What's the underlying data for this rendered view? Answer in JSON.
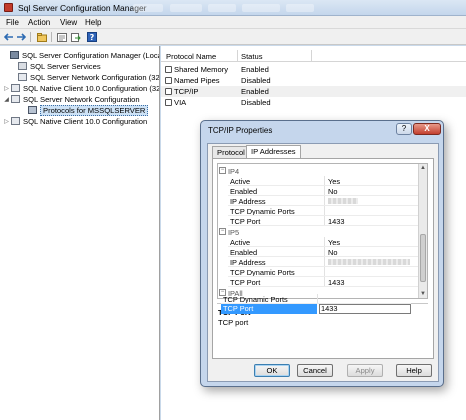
{
  "window": {
    "title": "Sql Server Configuration Manager"
  },
  "menu": [
    "File",
    "Action",
    "View",
    "Help"
  ],
  "toolbar": {
    "icons": [
      "back-arrow-icon",
      "forward-arrow-icon",
      "up-folder-icon",
      "properties-icon",
      "export-icon",
      "help-icon"
    ]
  },
  "tree": {
    "items": [
      {
        "label": "SQL Server Configuration Manager (Local)",
        "icon": "computer-icon"
      },
      {
        "label": "SQL Server Services",
        "icon": "server-icon"
      },
      {
        "label": "SQL Server Network Configuration (32bit",
        "icon": "network-icon"
      },
      {
        "label": "SQL Native Client 10.0 Configuration (32t",
        "icon": "client-icon",
        "expander": "▷"
      },
      {
        "label": "SQL Server Network Configuration",
        "icon": "network-icon",
        "expander": "◢"
      },
      {
        "label": "Protocols for MSSQLSERVER",
        "icon": "protocol-icon",
        "selected": true
      },
      {
        "label": "SQL Native Client 10.0 Configuration",
        "icon": "client-icon",
        "expander": "▷"
      }
    ]
  },
  "list": {
    "headers": {
      "name": "Protocol Name",
      "status": "Status"
    },
    "rows": [
      {
        "name": "Shared Memory",
        "status": "Enabled"
      },
      {
        "name": "Named Pipes",
        "status": "Disabled"
      },
      {
        "name": "TCP/IP",
        "status": "Enabled",
        "selected": true
      },
      {
        "name": "VIA",
        "status": "Disabled"
      }
    ]
  },
  "dialog": {
    "title": "TCP/IP Properties",
    "help_glyph": "?",
    "close_glyph": "X",
    "tabs": [
      "Protocol",
      "IP Addresses"
    ],
    "active_tab": 1,
    "grid": [
      {
        "type": "cat",
        "label": "IP4",
        "toggle": "−"
      },
      {
        "type": "prop",
        "key": "Active",
        "value": "Yes"
      },
      {
        "type": "prop",
        "key": "Enabled",
        "value": "No"
      },
      {
        "type": "prop",
        "key": "IP Address",
        "value": ""
      },
      {
        "type": "prop",
        "key": "TCP Dynamic Ports",
        "value": ""
      },
      {
        "type": "prop",
        "key": "TCP Port",
        "value": "1433"
      },
      {
        "type": "cat",
        "label": "IP5",
        "toggle": "−"
      },
      {
        "type": "prop",
        "key": "Active",
        "value": "Yes"
      },
      {
        "type": "prop",
        "key": "Enabled",
        "value": "No"
      },
      {
        "type": "prop",
        "key": "IP Address",
        "value": ""
      },
      {
        "type": "prop",
        "key": "TCP Dynamic Ports",
        "value": ""
      },
      {
        "type": "prop",
        "key": "TCP Port",
        "value": "1433"
      },
      {
        "type": "cat",
        "label": "IPAll",
        "toggle": "−"
      },
      {
        "type": "prop",
        "key": "TCP Dynamic Ports",
        "value": ""
      },
      {
        "type": "prop",
        "key": "TCP Port",
        "value": "1433",
        "selected": true
      }
    ],
    "description": {
      "title": "TCP Port",
      "text": "TCP port"
    },
    "buttons": {
      "ok": "OK",
      "cancel": "Cancel",
      "apply": "Apply",
      "help": "Help"
    }
  },
  "colors": {
    "selection": "#3399ff",
    "window_frame": "#c5d6ec"
  }
}
